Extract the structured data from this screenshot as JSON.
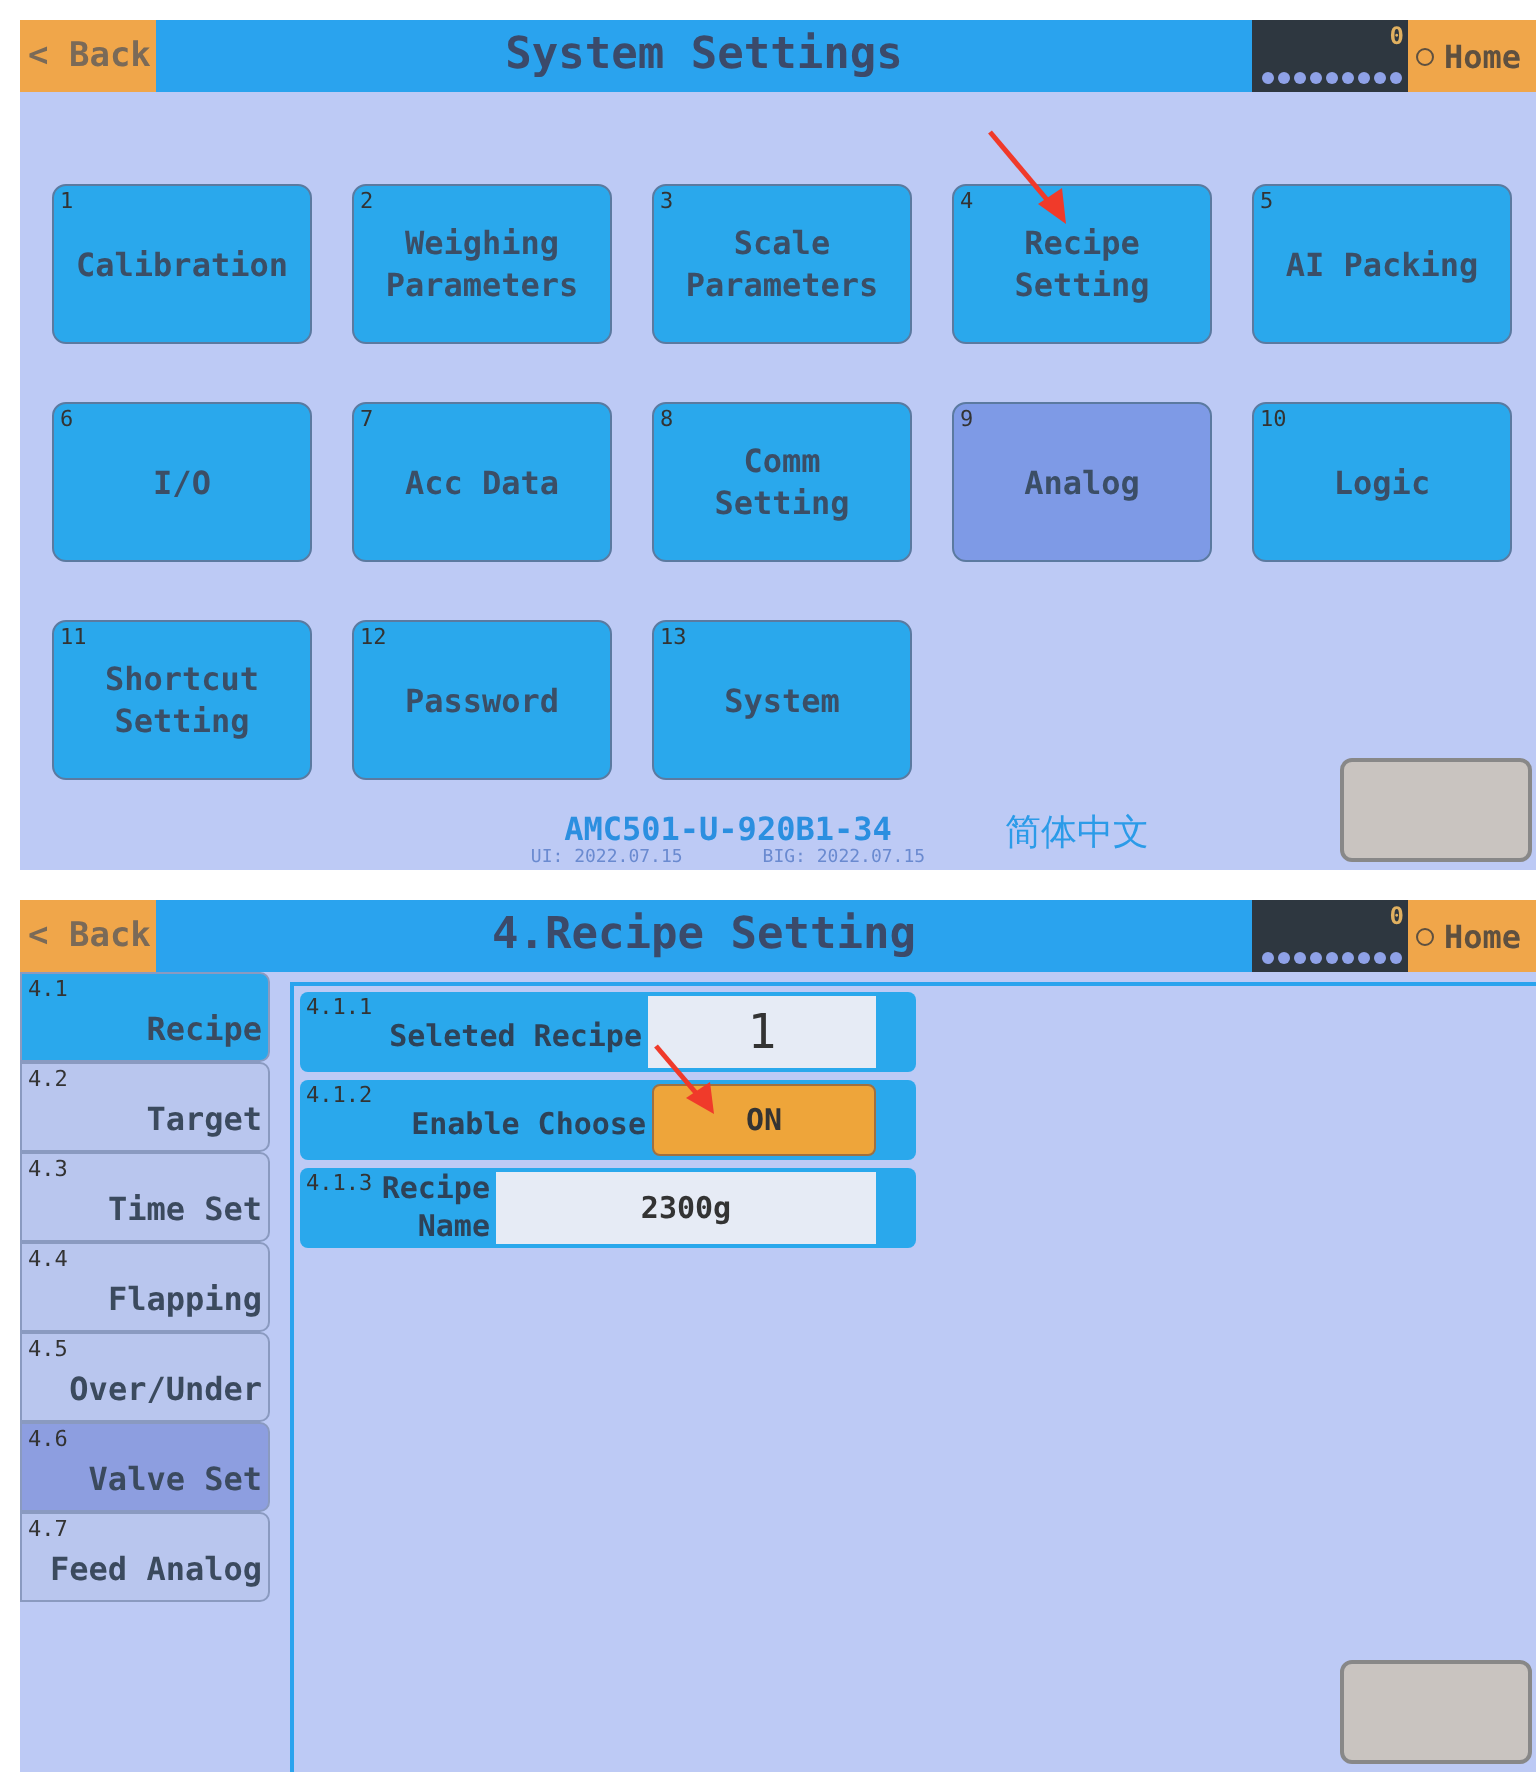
{
  "screens": [
    {
      "kind": "menu",
      "back": "< Back",
      "title": "System Settings",
      "counter": "0",
      "home": "Home",
      "tiles": [
        {
          "number": "1",
          "label": "Calibration",
          "dimmed": false
        },
        {
          "number": "2",
          "label": "Weighing Parameters",
          "dimmed": false
        },
        {
          "number": "3",
          "label": "Scale Parameters",
          "dimmed": false
        },
        {
          "number": "4",
          "label": "Recipe Setting",
          "dimmed": false
        },
        {
          "number": "5",
          "label": "AI Packing",
          "dimmed": false
        },
        {
          "number": "6",
          "label": "I/O",
          "dimmed": false
        },
        {
          "number": "7",
          "label": "Acc Data",
          "dimmed": false
        },
        {
          "number": "8",
          "label": "Comm Setting",
          "dimmed": false
        },
        {
          "number": "9",
          "label": "Analog",
          "dimmed": true
        },
        {
          "number": "10",
          "label": "Logic",
          "dimmed": false
        },
        {
          "number": "11",
          "label": "Shortcut Setting",
          "dimmed": false
        },
        {
          "number": "12",
          "label": "Password",
          "dimmed": false
        },
        {
          "number": "13",
          "label": "System",
          "dimmed": false
        }
      ],
      "footer": {
        "model": "AMC501-U-920B1-34",
        "ui_date": "UI: 2022.07.15",
        "bin_date": "BIG: 2022.07.15",
        "language": "简体中文"
      }
    },
    {
      "kind": "detail",
      "back": "< Back",
      "title": "4.Recipe Setting",
      "counter": "0",
      "home": "Home",
      "sidebar": [
        {
          "number": "4.1",
          "label": "Recipe",
          "selected": true,
          "dimmed": false
        },
        {
          "number": "4.2",
          "label": "Target",
          "selected": false,
          "dimmed": false
        },
        {
          "number": "4.3",
          "label": "Time Set",
          "selected": false,
          "dimmed": false
        },
        {
          "number": "4.4",
          "label": "Flapping",
          "selected": false,
          "dimmed": false
        },
        {
          "number": "4.5",
          "label": "Over/Under",
          "selected": false,
          "dimmed": false
        },
        {
          "number": "4.6",
          "label": "Valve Set",
          "selected": false,
          "dimmed": true
        },
        {
          "number": "4.7",
          "label": "Feed Analog",
          "selected": false,
          "dimmed": false
        }
      ],
      "settings": [
        {
          "number": "4.1.1",
          "label": "Seleted Recipe",
          "value": "1",
          "kind": "number"
        },
        {
          "number": "4.1.2",
          "label": "Enable Choose",
          "value": "ON",
          "kind": "toggle"
        },
        {
          "number": "4.1.3",
          "label": "Recipe Name",
          "value": "2300g",
          "kind": "text"
        }
      ]
    }
  ]
}
